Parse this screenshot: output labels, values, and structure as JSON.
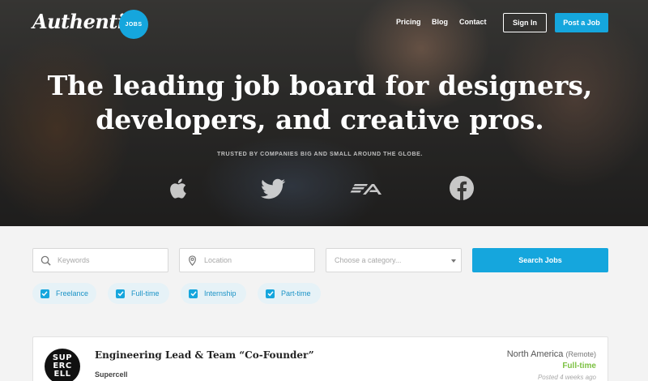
{
  "header": {
    "logo_text": "Authentic",
    "logo_badge": "JOBS",
    "nav": [
      "Pricing",
      "Blog",
      "Contact"
    ],
    "sign_in": "Sign In",
    "post_job": "Post a Job"
  },
  "hero": {
    "headline_line1": "The leading job board for designers,",
    "headline_line2": "developers, and creative pros.",
    "trusted": "TRUSTED BY COMPANIES BIG AND SMALL AROUND THE GLOBE.",
    "brands": [
      "apple-icon",
      "twitter-icon",
      "ea-icon",
      "facebook-icon"
    ]
  },
  "search": {
    "keywords_placeholder": "Keywords",
    "location_placeholder": "Location",
    "category_placeholder": "Choose a category...",
    "button": "Search Jobs"
  },
  "filters": [
    {
      "label": "Freelance",
      "checked": true
    },
    {
      "label": "Full-time",
      "checked": true
    },
    {
      "label": "Internship",
      "checked": true
    },
    {
      "label": "Part-time",
      "checked": true
    }
  ],
  "job": {
    "title": "Engineering Lead & Team “Co-Founder”",
    "company": "Supercell",
    "logo_text": "SUP ERC ELL",
    "location": "North America",
    "location_note": "(Remote)",
    "type": "Full-time",
    "posted": "Posted 4 weeks ago"
  },
  "colors": {
    "accent": "#15a6dd",
    "fulltime": "#7cc142"
  }
}
